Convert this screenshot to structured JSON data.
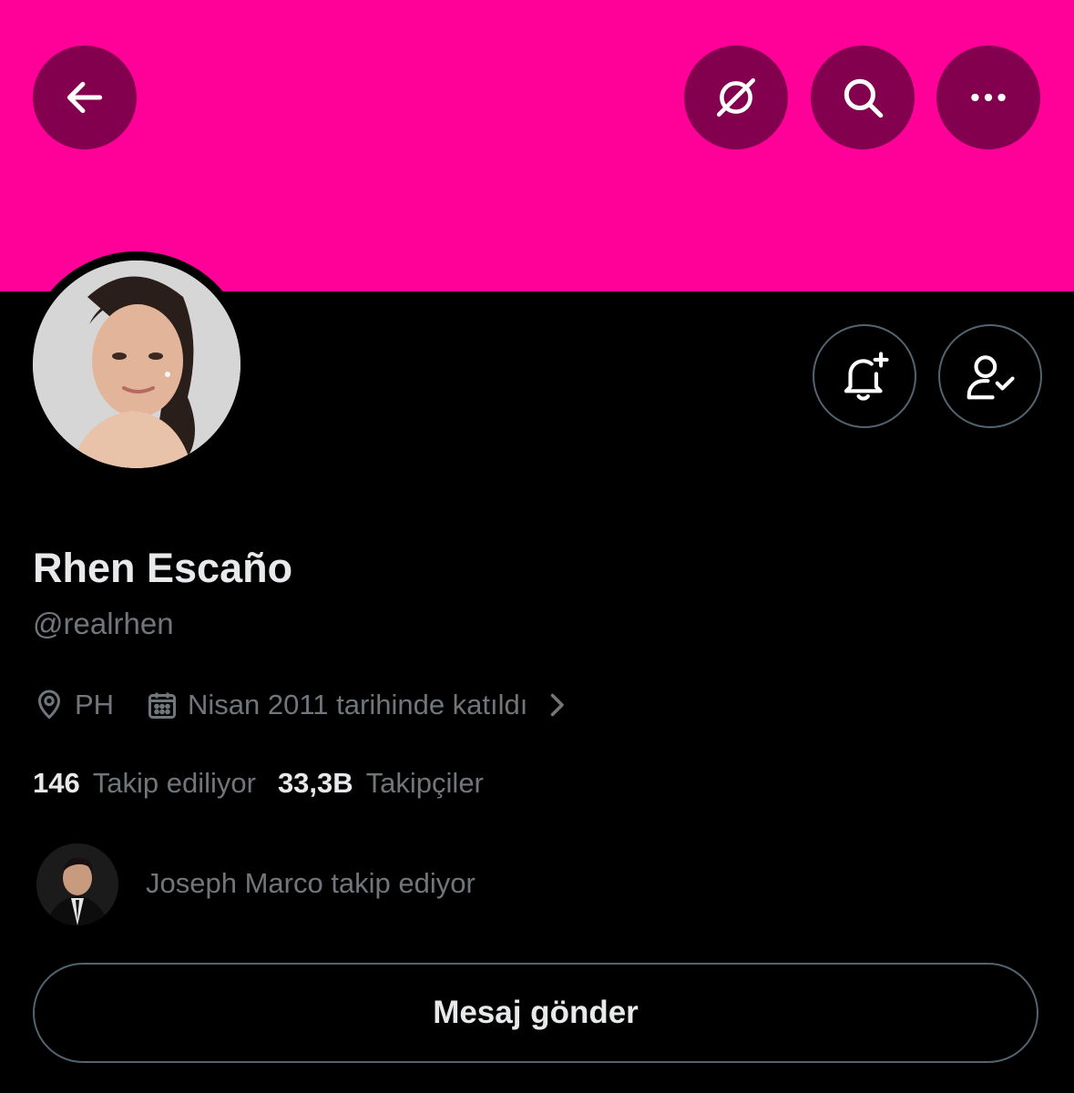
{
  "banner": {
    "color": "#ff0099"
  },
  "header": {
    "back_icon": "arrow-left-icon",
    "grok_icon": "grok-icon",
    "search_icon": "search-icon",
    "more_icon": "more-horizontal-icon",
    "button_color": "#82004d"
  },
  "actions": {
    "notify_icon": "bell-plus-icon",
    "following_icon": "user-check-icon"
  },
  "profile": {
    "name": "Rhen Escaño",
    "handle": "@realrhen",
    "location": "PH",
    "joined": "Nisan 2011 tarihinde katıldı",
    "following_count": "146",
    "following_label": "Takip ediliyor",
    "followers_count": "33,3B",
    "followers_label": "Takipçiler"
  },
  "followed_by": {
    "text": "Joseph Marco takip ediyor"
  },
  "message_button": {
    "label": "Mesaj gönder"
  }
}
